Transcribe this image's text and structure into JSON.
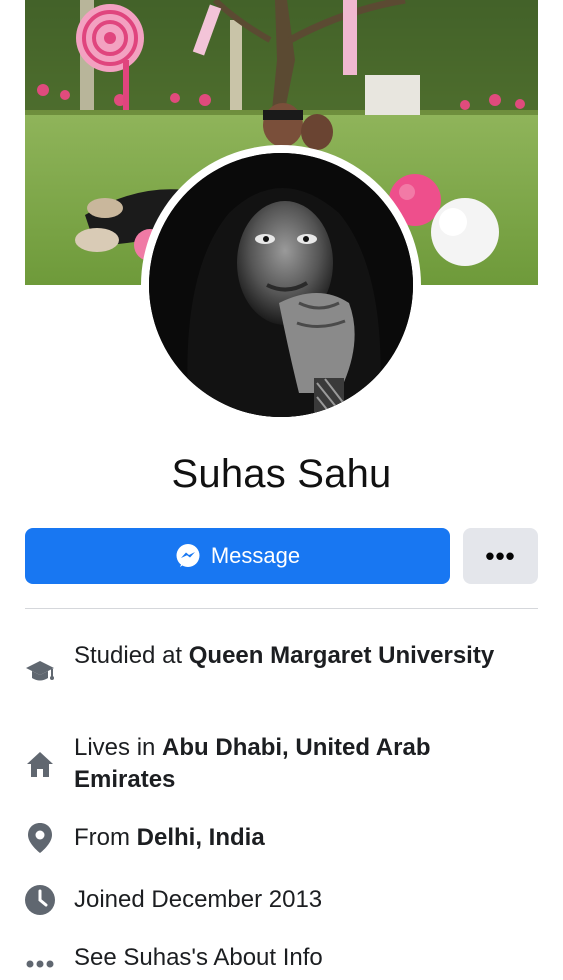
{
  "profile": {
    "name": "Suhas Sahu"
  },
  "actions": {
    "message_label": "Message",
    "more_label": "•••"
  },
  "info": {
    "education": {
      "prefix": "Studied at ",
      "value": "Queen Margaret University"
    },
    "lives": {
      "prefix": "Lives in ",
      "value": "Abu Dhabi, United Arab Emirates"
    },
    "from": {
      "prefix": "From ",
      "value": "Delhi, India"
    },
    "joined": {
      "text": "Joined December 2013"
    },
    "about": {
      "text": "See Suhas's About Info"
    }
  },
  "colors": {
    "primary": "#1877f2",
    "icon": "#606770",
    "secondary_button": "#e4e6eb"
  },
  "icons": [
    "messenger-icon",
    "graduation-cap-icon",
    "home-icon",
    "location-pin-icon",
    "clock-icon",
    "more-dots-icon"
  ]
}
